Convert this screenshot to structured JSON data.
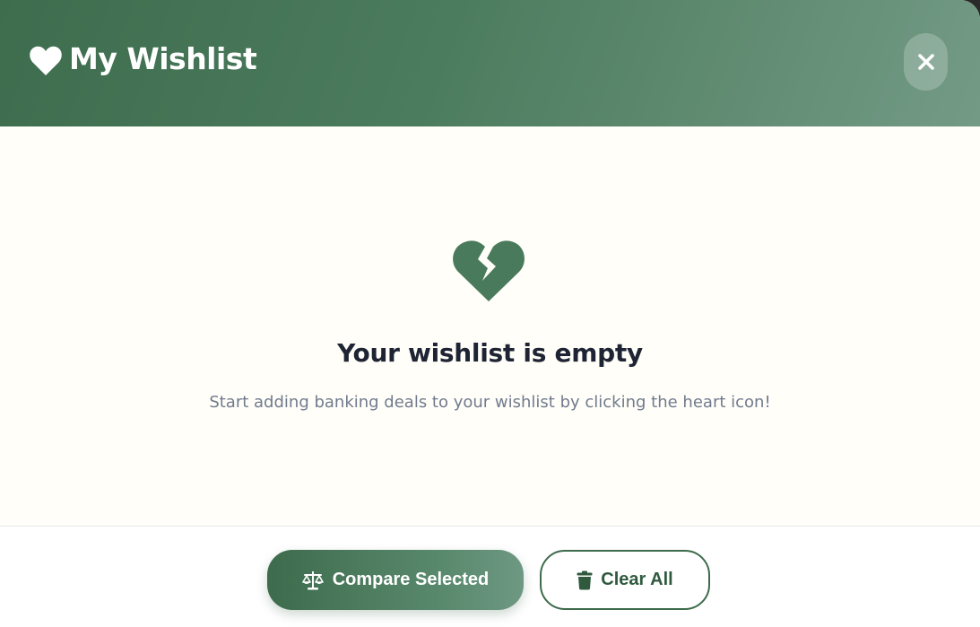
{
  "header": {
    "title": "My Wishlist",
    "icon": "heart-icon",
    "close_icon": "close-icon"
  },
  "empty_state": {
    "icon": "broken-heart-icon",
    "title": "Your wishlist is empty",
    "message": "Start adding banking deals to your wishlist by clicking the heart icon!"
  },
  "footer": {
    "compare_label": "Compare Selected",
    "compare_icon": "scale-icon",
    "clear_label": "Clear All",
    "clear_icon": "trash-icon"
  },
  "colors": {
    "brand_green": "#3d6b4c",
    "header_gradient_end": "#739a85",
    "body_background": "#fffef8",
    "title_text": "#1e2433",
    "muted_text": "#717b8f"
  }
}
